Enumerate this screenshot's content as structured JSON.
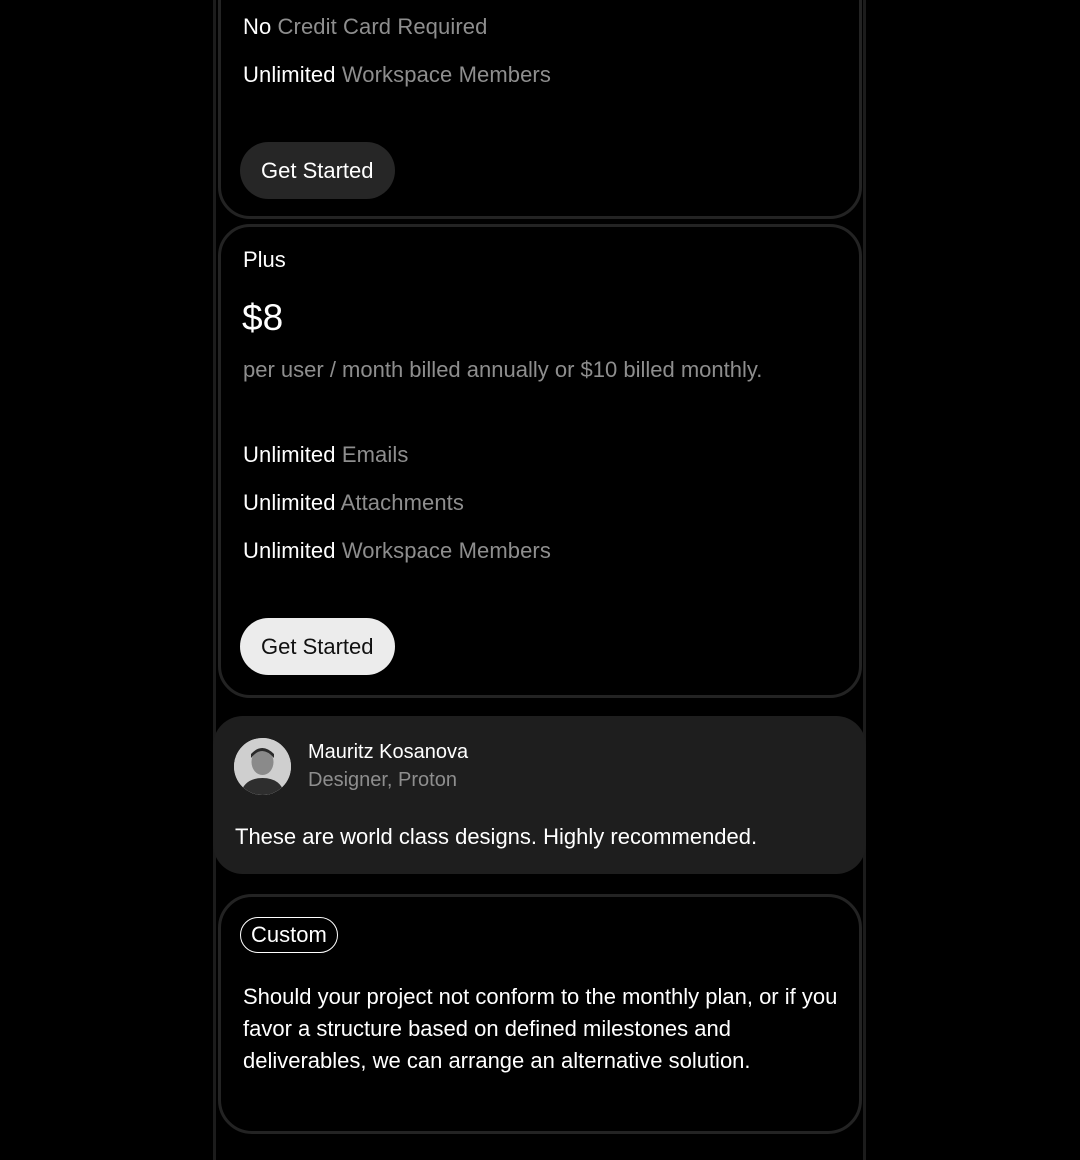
{
  "free_plan": {
    "features": [
      {
        "key": "No",
        "value": "Credit Card Required"
      },
      {
        "key": "Unlimited",
        "value": "Workspace Members"
      }
    ],
    "button_label": "Get Started"
  },
  "plus_plan": {
    "name": "Plus",
    "price": "$8",
    "billing_note": "per user / month billed annually or $10 billed monthly.",
    "features": [
      {
        "key": "Unlimited",
        "value": "Emails"
      },
      {
        "key": "Unlimited",
        "value": "Attachments"
      },
      {
        "key": "Unlimited",
        "value": "Workspace Members"
      }
    ],
    "button_label": "Get Started"
  },
  "testimonial": {
    "name": "Mauritz Kosanova",
    "role": "Designer, Proton",
    "quote": "These are world class designs. Highly recommended."
  },
  "custom_plan": {
    "badge": "Custom",
    "description": "Should your project not conform to the monthly plan, or if you favor a structure based on defined milestones and deliverables, we can arrange an alternative solution."
  },
  "colors": {
    "background": "#000000",
    "card_border": "#232323",
    "muted_text": "#8e8e8e",
    "button_dark": "#262626",
    "button_light": "#ececec",
    "testimonial_bg": "#1e1e1e"
  }
}
